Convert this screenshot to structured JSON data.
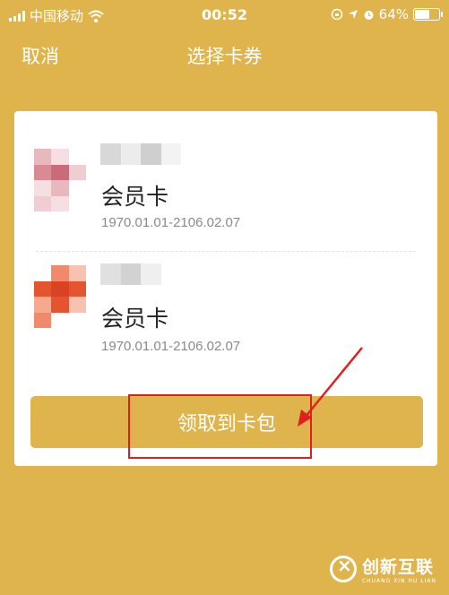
{
  "status_bar": {
    "carrier": "中国移动",
    "time": "00:52",
    "battery": "64%",
    "battery_level": 0.64
  },
  "nav": {
    "cancel_label": "取消",
    "title": "选择卡券"
  },
  "coupons": [
    {
      "name": "会员卡",
      "validity": "1970.01.01-2106.02.07",
      "logo_palette": [
        "#d98b95",
        "#e8b8bf",
        "#f5dfe2",
        "#c96b7a",
        "#f0cdd2",
        "#ffffff"
      ]
    },
    {
      "name": "会员卡",
      "validity": "1970.01.01-2106.02.07",
      "logo_palette": [
        "#e4542f",
        "#f08a6a",
        "#f7c2b0",
        "#d94323",
        "#f5a98f",
        "#ffffff"
      ]
    }
  ],
  "claim_button_label": "领取到卡包",
  "watermark": {
    "main": "创新互联",
    "sub": "CHUANG XIN HU LIAN"
  },
  "colors": {
    "accent": "#e0b44c",
    "annotation": "#e02020"
  }
}
